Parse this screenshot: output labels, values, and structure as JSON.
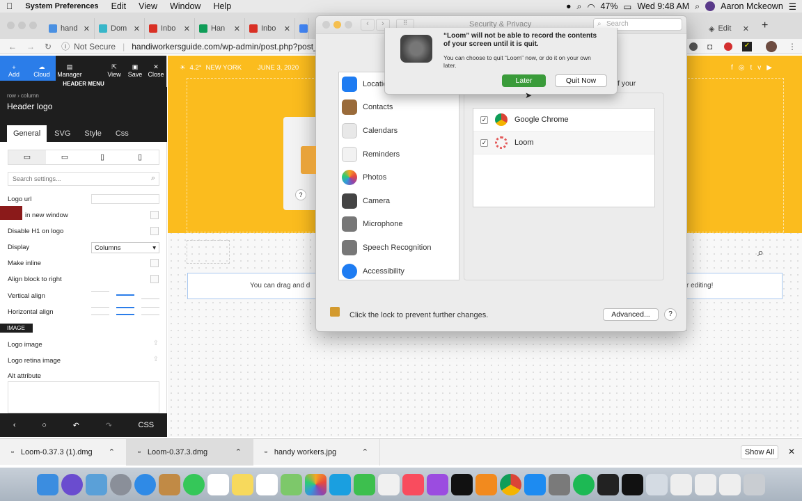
{
  "menubar": {
    "apple": "",
    "app": "System Preferences",
    "items": [
      "Edit",
      "View",
      "Window",
      "Help"
    ],
    "battery": "47%",
    "clock": "Wed 9:48 AM",
    "user": "Aaron Mckeown"
  },
  "browser": {
    "tabs": [
      {
        "label": "hand",
        "color": "#4a90e2"
      },
      {
        "label": "Dom",
        "color": "#38b6c9"
      },
      {
        "label": "Inbo",
        "color": "#d93025"
      },
      {
        "label": "Han",
        "color": "#0f9d58"
      },
      {
        "label": "Inbo",
        "color": "#d93025"
      },
      {
        "label": "",
        "color": "#4285f4"
      }
    ],
    "right_tab": "Edit",
    "security": "Not Secure",
    "url": "handiworkersguide.com/wp-admin/post.php?post_"
  },
  "editor": {
    "toolbar": [
      "Add",
      "Cloud",
      "Manager",
      "View",
      "Save",
      "Close"
    ],
    "header_menu": "HEADER MENU",
    "breadcrumb": "row  ›  column",
    "title": "Header logo",
    "tabs": [
      "General",
      "SVG",
      "Style",
      "Css"
    ],
    "search_placeholder": "Search settings...",
    "settings": {
      "logo_url": "Logo url",
      "new_window": "in new window",
      "disable_h1": "Disable H1 on logo",
      "display": "Display",
      "display_value": "Columns",
      "make_inline": "Make inline",
      "align_right": "Align block to right",
      "vertical_align": "Vertical align",
      "horizontal_align": "Horizontal align",
      "image_section": "IMAGE",
      "logo_image": "Logo image",
      "logo_retina": "Logo retina image",
      "alt": "Alt attribute"
    },
    "bottom": {
      "css": "CSS"
    }
  },
  "page": {
    "temp": "4.2°",
    "city": "NEW YORK",
    "date": "JUNE 3, 2020",
    "drag_text_left": "You can drag and d",
    "drag_text_right": "r editing!"
  },
  "prefs": {
    "title": "Security & Privacy",
    "search": "Search",
    "list": [
      {
        "label": "Locatio",
        "color": "#1e7cf2"
      },
      {
        "label": "Contacts",
        "color": "#9a6b3a"
      },
      {
        "label": "Calendars",
        "color": "#e8e8e8"
      },
      {
        "label": "Reminders",
        "color": "#f2f2f2"
      },
      {
        "label": "Photos",
        "color": "#f4a623"
      },
      {
        "label": "Camera",
        "color": "#444444"
      },
      {
        "label": "Microphone",
        "color": "#777777"
      },
      {
        "label": "Speech Recognition",
        "color": "#777777"
      },
      {
        "label": "Accessibility",
        "color": "#1e7cf2"
      }
    ],
    "desc_tail": "s of your",
    "apps": [
      {
        "name": "Google Chrome",
        "checked": "✓"
      },
      {
        "name": "Loom",
        "checked": "✓"
      }
    ],
    "lock_text": "Click the lock to prevent further changes.",
    "advanced": "Advanced...",
    "help": "?"
  },
  "alert": {
    "title": "“Loom” will not be able to record the contents of your screen until it is quit.",
    "body": "You can choose to quit “Loom” now, or do it on your own later.",
    "later": "Later",
    "quit": "Quit Now"
  },
  "downloads": {
    "items": [
      "Loom-0.37.3 (1).dmg",
      "Loom-0.37.3.dmg",
      "handy workers.jpg"
    ],
    "show_all": "Show All"
  },
  "colors": {
    "accent": "#fbbc1e",
    "editor_dark": "#1e1e1e",
    "later_green": "#3a9b3a"
  }
}
